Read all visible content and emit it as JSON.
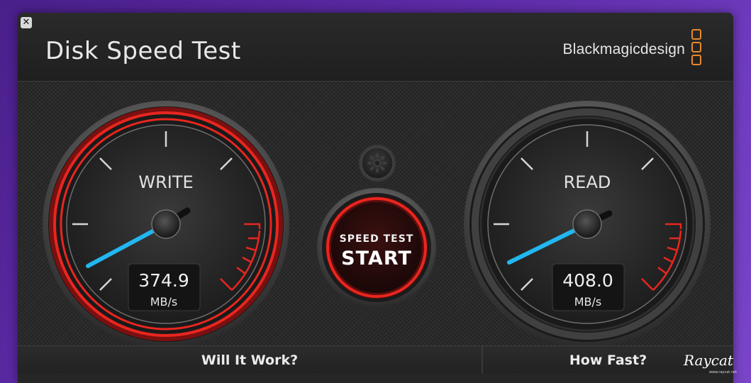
{
  "window": {
    "title": "Disk Speed Test",
    "brand": "Blackmagicdesign",
    "close_label": "✕"
  },
  "write_gauge": {
    "label": "WRITE",
    "value": "374.9",
    "unit": "MB/s"
  },
  "read_gauge": {
    "label": "READ",
    "value": "408.0",
    "unit": "MB/s"
  },
  "start_button": {
    "line1": "SPEED TEST",
    "line2": "START"
  },
  "settings": {
    "icon": "gear-icon"
  },
  "tabs": {
    "left": "Will It Work?",
    "right": "How Fast?"
  },
  "watermark": {
    "text": "Raycat",
    "sub": "www.raycat.net"
  },
  "colors": {
    "accent_red": "#e8261f",
    "needle_blue": "#22b7f0",
    "brand_orange": "#e8892c"
  }
}
